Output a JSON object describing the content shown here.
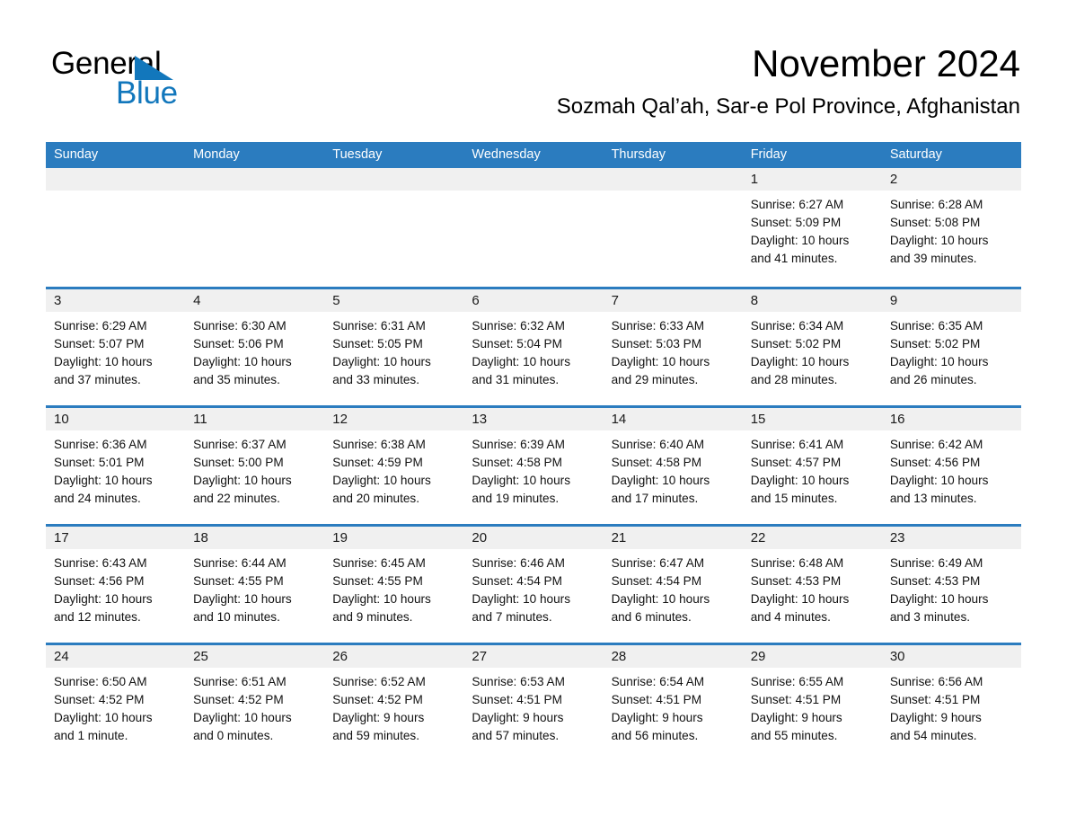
{
  "logo": {
    "word_one": "General",
    "word_two": "Blue",
    "triangle_color": "#1277BC"
  },
  "header": {
    "title": "November 2024",
    "subtitle": "Sozmah Qal’ah, Sar-e Pol Province, Afghanistan",
    "accent_color": "#2B7CBF"
  },
  "calendar": {
    "weekdays": [
      "Sunday",
      "Monday",
      "Tuesday",
      "Wednesday",
      "Thursday",
      "Friday",
      "Saturday"
    ],
    "weeks": [
      [
        {
          "day": "",
          "sunrise": "",
          "sunset": "",
          "daylight_line1": "",
          "daylight_line2": ""
        },
        {
          "day": "",
          "sunrise": "",
          "sunset": "",
          "daylight_line1": "",
          "daylight_line2": ""
        },
        {
          "day": "",
          "sunrise": "",
          "sunset": "",
          "daylight_line1": "",
          "daylight_line2": ""
        },
        {
          "day": "",
          "sunrise": "",
          "sunset": "",
          "daylight_line1": "",
          "daylight_line2": ""
        },
        {
          "day": "",
          "sunrise": "",
          "sunset": "",
          "daylight_line1": "",
          "daylight_line2": ""
        },
        {
          "day": "1",
          "sunrise": "Sunrise: 6:27 AM",
          "sunset": "Sunset: 5:09 PM",
          "daylight_line1": "Daylight: 10 hours",
          "daylight_line2": "and 41 minutes."
        },
        {
          "day": "2",
          "sunrise": "Sunrise: 6:28 AM",
          "sunset": "Sunset: 5:08 PM",
          "daylight_line1": "Daylight: 10 hours",
          "daylight_line2": "and 39 minutes."
        }
      ],
      [
        {
          "day": "3",
          "sunrise": "Sunrise: 6:29 AM",
          "sunset": "Sunset: 5:07 PM",
          "daylight_line1": "Daylight: 10 hours",
          "daylight_line2": "and 37 minutes."
        },
        {
          "day": "4",
          "sunrise": "Sunrise: 6:30 AM",
          "sunset": "Sunset: 5:06 PM",
          "daylight_line1": "Daylight: 10 hours",
          "daylight_line2": "and 35 minutes."
        },
        {
          "day": "5",
          "sunrise": "Sunrise: 6:31 AM",
          "sunset": "Sunset: 5:05 PM",
          "daylight_line1": "Daylight: 10 hours",
          "daylight_line2": "and 33 minutes."
        },
        {
          "day": "6",
          "sunrise": "Sunrise: 6:32 AM",
          "sunset": "Sunset: 5:04 PM",
          "daylight_line1": "Daylight: 10 hours",
          "daylight_line2": "and 31 minutes."
        },
        {
          "day": "7",
          "sunrise": "Sunrise: 6:33 AM",
          "sunset": "Sunset: 5:03 PM",
          "daylight_line1": "Daylight: 10 hours",
          "daylight_line2": "and 29 minutes."
        },
        {
          "day": "8",
          "sunrise": "Sunrise: 6:34 AM",
          "sunset": "Sunset: 5:02 PM",
          "daylight_line1": "Daylight: 10 hours",
          "daylight_line2": "and 28 minutes."
        },
        {
          "day": "9",
          "sunrise": "Sunrise: 6:35 AM",
          "sunset": "Sunset: 5:02 PM",
          "daylight_line1": "Daylight: 10 hours",
          "daylight_line2": "and 26 minutes."
        }
      ],
      [
        {
          "day": "10",
          "sunrise": "Sunrise: 6:36 AM",
          "sunset": "Sunset: 5:01 PM",
          "daylight_line1": "Daylight: 10 hours",
          "daylight_line2": "and 24 minutes."
        },
        {
          "day": "11",
          "sunrise": "Sunrise: 6:37 AM",
          "sunset": "Sunset: 5:00 PM",
          "daylight_line1": "Daylight: 10 hours",
          "daylight_line2": "and 22 minutes."
        },
        {
          "day": "12",
          "sunrise": "Sunrise: 6:38 AM",
          "sunset": "Sunset: 4:59 PM",
          "daylight_line1": "Daylight: 10 hours",
          "daylight_line2": "and 20 minutes."
        },
        {
          "day": "13",
          "sunrise": "Sunrise: 6:39 AM",
          "sunset": "Sunset: 4:58 PM",
          "daylight_line1": "Daylight: 10 hours",
          "daylight_line2": "and 19 minutes."
        },
        {
          "day": "14",
          "sunrise": "Sunrise: 6:40 AM",
          "sunset": "Sunset: 4:58 PM",
          "daylight_line1": "Daylight: 10 hours",
          "daylight_line2": "and 17 minutes."
        },
        {
          "day": "15",
          "sunrise": "Sunrise: 6:41 AM",
          "sunset": "Sunset: 4:57 PM",
          "daylight_line1": "Daylight: 10 hours",
          "daylight_line2": "and 15 minutes."
        },
        {
          "day": "16",
          "sunrise": "Sunrise: 6:42 AM",
          "sunset": "Sunset: 4:56 PM",
          "daylight_line1": "Daylight: 10 hours",
          "daylight_line2": "and 13 minutes."
        }
      ],
      [
        {
          "day": "17",
          "sunrise": "Sunrise: 6:43 AM",
          "sunset": "Sunset: 4:56 PM",
          "daylight_line1": "Daylight: 10 hours",
          "daylight_line2": "and 12 minutes."
        },
        {
          "day": "18",
          "sunrise": "Sunrise: 6:44 AM",
          "sunset": "Sunset: 4:55 PM",
          "daylight_line1": "Daylight: 10 hours",
          "daylight_line2": "and 10 minutes."
        },
        {
          "day": "19",
          "sunrise": "Sunrise: 6:45 AM",
          "sunset": "Sunset: 4:55 PM",
          "daylight_line1": "Daylight: 10 hours",
          "daylight_line2": "and 9 minutes."
        },
        {
          "day": "20",
          "sunrise": "Sunrise: 6:46 AM",
          "sunset": "Sunset: 4:54 PM",
          "daylight_line1": "Daylight: 10 hours",
          "daylight_line2": "and 7 minutes."
        },
        {
          "day": "21",
          "sunrise": "Sunrise: 6:47 AM",
          "sunset": "Sunset: 4:54 PM",
          "daylight_line1": "Daylight: 10 hours",
          "daylight_line2": "and 6 minutes."
        },
        {
          "day": "22",
          "sunrise": "Sunrise: 6:48 AM",
          "sunset": "Sunset: 4:53 PM",
          "daylight_line1": "Daylight: 10 hours",
          "daylight_line2": "and 4 minutes."
        },
        {
          "day": "23",
          "sunrise": "Sunrise: 6:49 AM",
          "sunset": "Sunset: 4:53 PM",
          "daylight_line1": "Daylight: 10 hours",
          "daylight_line2": "and 3 minutes."
        }
      ],
      [
        {
          "day": "24",
          "sunrise": "Sunrise: 6:50 AM",
          "sunset": "Sunset: 4:52 PM",
          "daylight_line1": "Daylight: 10 hours",
          "daylight_line2": "and 1 minute."
        },
        {
          "day": "25",
          "sunrise": "Sunrise: 6:51 AM",
          "sunset": "Sunset: 4:52 PM",
          "daylight_line1": "Daylight: 10 hours",
          "daylight_line2": "and 0 minutes."
        },
        {
          "day": "26",
          "sunrise": "Sunrise: 6:52 AM",
          "sunset": "Sunset: 4:52 PM",
          "daylight_line1": "Daylight: 9 hours",
          "daylight_line2": "and 59 minutes."
        },
        {
          "day": "27",
          "sunrise": "Sunrise: 6:53 AM",
          "sunset": "Sunset: 4:51 PM",
          "daylight_line1": "Daylight: 9 hours",
          "daylight_line2": "and 57 minutes."
        },
        {
          "day": "28",
          "sunrise": "Sunrise: 6:54 AM",
          "sunset": "Sunset: 4:51 PM",
          "daylight_line1": "Daylight: 9 hours",
          "daylight_line2": "and 56 minutes."
        },
        {
          "day": "29",
          "sunrise": "Sunrise: 6:55 AM",
          "sunset": "Sunset: 4:51 PM",
          "daylight_line1": "Daylight: 9 hours",
          "daylight_line2": "and 55 minutes."
        },
        {
          "day": "30",
          "sunrise": "Sunrise: 6:56 AM",
          "sunset": "Sunset: 4:51 PM",
          "daylight_line1": "Daylight: 9 hours",
          "daylight_line2": "and 54 minutes."
        }
      ]
    ]
  }
}
